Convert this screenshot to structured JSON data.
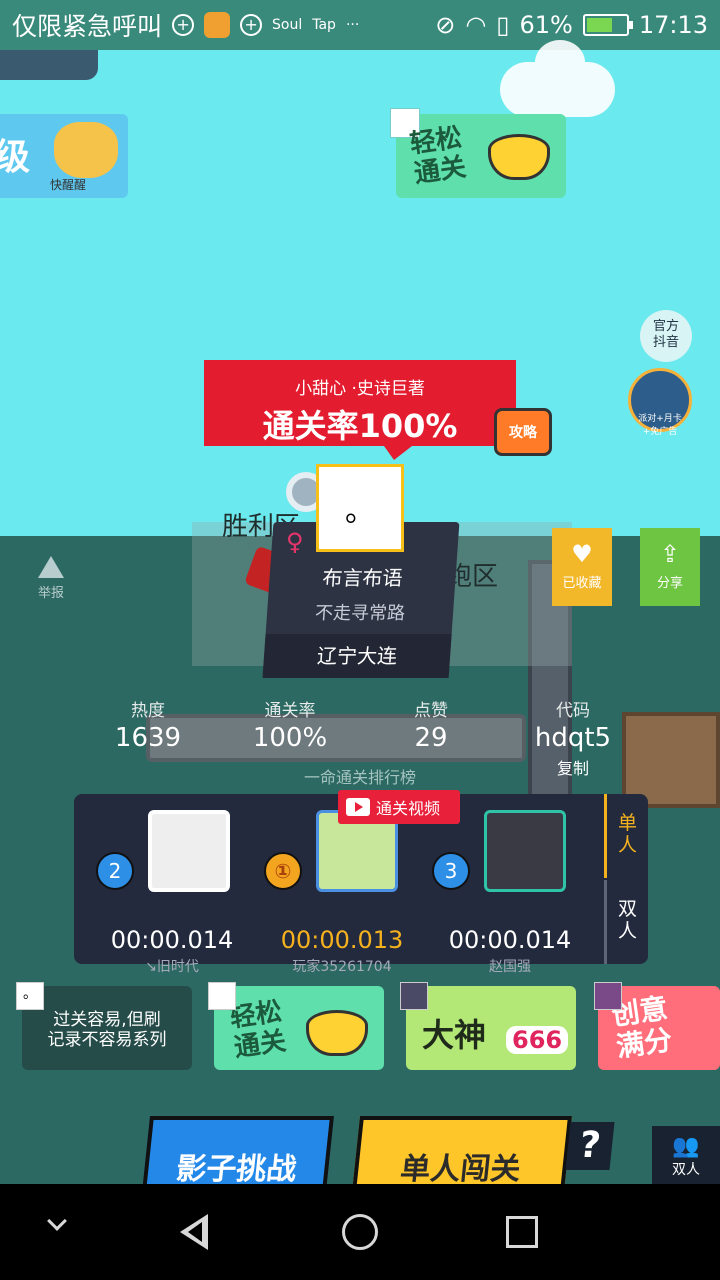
{
  "status_bar": {
    "carrier": "仅限紧急呼叫",
    "app_icons": [
      "Soul",
      "Tap",
      "···"
    ],
    "battery": "61%",
    "battery_level": 0.61,
    "time": "17:13"
  },
  "level_tags": {
    "left_tag": "级",
    "left_tag_sub": "快醒醒",
    "top_right_tag": "轻松\n通关"
  },
  "side": {
    "official": "官方\n抖音",
    "party": "派对+月卡\n+免广告"
  },
  "banner": {
    "subtitle": "小甜心 ·史诗巨著",
    "title": "通关率100%",
    "guide_label": "攻略"
  },
  "zones": {
    "victory": "胜利区",
    "run": "跑区"
  },
  "author": {
    "avatar_char": "。",
    "name": "布言布语",
    "motto": "不走寻常路",
    "location": "辽宁大连"
  },
  "actions": {
    "report": "举报",
    "favorite": "已收藏",
    "share": "分享"
  },
  "stats": {
    "heat_label": "热度",
    "heat_value": "1639",
    "pass_rate_label": "通关率",
    "pass_rate_value": "100%",
    "likes_label": "点赞",
    "likes_value": "29",
    "code_label": "代码",
    "code_value": "hdqt5",
    "copy_label": "复制"
  },
  "leaderboard": {
    "title": "一命通关排行榜",
    "video_badge": "通关视频",
    "entries": [
      {
        "rank": "2",
        "time": "00:00.014",
        "name": "↘旧时代"
      },
      {
        "rank": "①",
        "time": "00:00.013",
        "name": "玩家35261704"
      },
      {
        "rank": "3",
        "time": "00:00.014",
        "name": "赵国强"
      }
    ],
    "tabs": [
      "单\n人",
      "双\n人"
    ]
  },
  "series": [
    {
      "label": "过关容易,但刷\n记录不容易系列",
      "thumb": "。"
    },
    {
      "label": "轻松\n通关"
    },
    {
      "label": "大神"
    },
    {
      "label": "666"
    },
    {
      "label": "创意\n满分"
    }
  ],
  "buttons": {
    "shadow": "影子挑战",
    "single": "单人闯关",
    "help": "?",
    "duo": "双人"
  },
  "colors": {
    "sky": "#6ae9ee",
    "ground": "#2c6962",
    "banner_red": "#e31d2f",
    "accent_gold": "#f6b21e",
    "share_green": "#6dc541"
  }
}
